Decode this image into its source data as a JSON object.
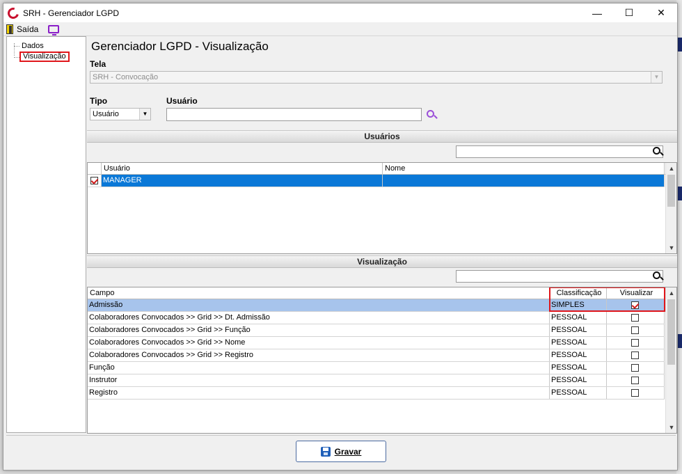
{
  "window": {
    "title": "SRH - Gerenciador LGPD",
    "minimize": "—",
    "maximize": "☐",
    "close": "✕"
  },
  "toolbar": {
    "exit_label": "Saída"
  },
  "tree": {
    "items": [
      {
        "label": "Dados",
        "selected": false
      },
      {
        "label": "Visualização",
        "selected": true
      }
    ]
  },
  "main": {
    "heading": "Gerenciador LGPD - Visualização",
    "tela_label": "Tela",
    "tela_value": "SRH - Convocação",
    "tipo_label": "Tipo",
    "tipo_value": "Usuário",
    "usuario_label": "Usuário",
    "usuario_value": ""
  },
  "users_section": {
    "title": "Usuários",
    "search_value": "",
    "columns": [
      "Usuário",
      "Nome"
    ],
    "rows": [
      {
        "checked": true,
        "usuario": "MANAGER",
        "nome": ""
      }
    ]
  },
  "view_section": {
    "title": "Visualização",
    "search_value": "",
    "columns": [
      "Campo",
      "Classificação",
      "Visualizar"
    ],
    "rows": [
      {
        "campo": "Admissão",
        "classificacao": "SIMPLES",
        "visualizar": true
      },
      {
        "campo": "Colaboradores Convocados >> Grid >> Dt. Admissão",
        "classificacao": "PESSOAL",
        "visualizar": false
      },
      {
        "campo": "Colaboradores Convocados >> Grid >> Função",
        "classificacao": "PESSOAL",
        "visualizar": false
      },
      {
        "campo": "Colaboradores Convocados >> Grid >> Nome",
        "classificacao": "PESSOAL",
        "visualizar": false
      },
      {
        "campo": "Colaboradores Convocados >> Grid >> Registro",
        "classificacao": "PESSOAL",
        "visualizar": false
      },
      {
        "campo": "Função",
        "classificacao": "PESSOAL",
        "visualizar": false
      },
      {
        "campo": "Instrutor",
        "classificacao": "PESSOAL",
        "visualizar": false
      },
      {
        "campo": "Registro",
        "classificacao": "PESSOAL",
        "visualizar": false
      }
    ]
  },
  "footer": {
    "save_label": "Gravar"
  },
  "colors": {
    "selection_blue": "#0a78d7",
    "selection_light": "#a7c4ec",
    "highlight_red": "#e0161b"
  }
}
